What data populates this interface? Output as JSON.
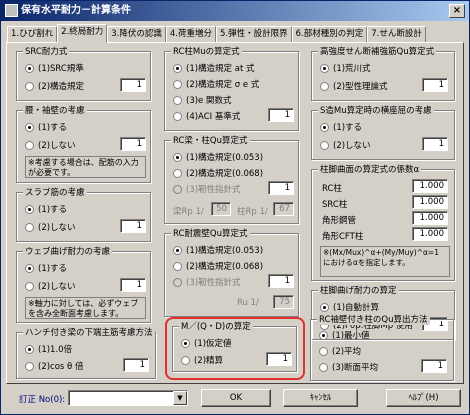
{
  "window": {
    "title": "保有水平耐力－計算条件",
    "close": "×"
  },
  "tabs": [
    "1.ひび割れ",
    "2.終局耐力",
    "3.降伏の認識",
    "4.荷重増分",
    "5.弾性・設計限界",
    "6.部材種別の判定",
    "7.せん断設計"
  ],
  "src": {
    "legend": "SRC耐力式",
    "opts": [
      "(1)SRC規準",
      "(2)構造規定"
    ],
    "val": "1"
  },
  "koshi": {
    "legend": "腰・袖壁の考慮",
    "opts": [
      "(1)する",
      "(2)しない"
    ],
    "val": "1",
    "note": "※考慮する場合は、配筋の入力が必要です。"
  },
  "slab": {
    "legend": "スラブ筋の考慮",
    "opts": [
      "(1)する",
      "(2)しない"
    ],
    "val": "1"
  },
  "web": {
    "legend": "ウェブ曲げ耐力の考慮",
    "opts": [
      "(1)する",
      "(2)しない"
    ],
    "val": "1",
    "note": "※軸力に対しては、必ずウェブを含み全断面考慮します。"
  },
  "haunch": {
    "legend": "ハンチ付き梁の下端主筋考慮方法",
    "opts": [
      "(1)1.0倍",
      "(2)cos θ 倍"
    ],
    "val": "1"
  },
  "rcmu": {
    "legend": "RC柱Muの算定式",
    "opts": [
      "(1)構造規定 at 式",
      "(2)構造規定 σ e 式",
      "(3)e 関数式",
      "(4)ACI 基準式"
    ],
    "val": "1"
  },
  "rcqu": {
    "legend": "RC梁・柱Qu算定式",
    "opts": [
      "(1)構造規定(0.053)",
      "(2)構造規定(0.068)",
      "(3)靭性指針式"
    ],
    "val": "1",
    "rp_beam_label": "梁Rp 1/",
    "rp_beam": "50",
    "rp_col_label": "柱Rp 1/",
    "rp_col": "67"
  },
  "wallqu": {
    "legend": "RC耐震壁Qu算定式",
    "opts": [
      "(1)構造規定(0.053)",
      "(2)構造規定(0.068)",
      "(3)靭性指針式"
    ],
    "val": "1",
    "ru_label": "Ru 1/",
    "ru": "75"
  },
  "mqd": {
    "legend": "M／(Q・D)の算定",
    "opts": [
      "(1)仮定値",
      "(2)精算"
    ],
    "val": "1"
  },
  "hsqu": {
    "legend": "高強度せん断補強筋Qu算定式",
    "opts": [
      "(1)荒川式",
      "(2)型性理論式"
    ],
    "val": "1"
  },
  "smu": {
    "legend": "S造Mu算定時の横座屈の考慮",
    "opts": [
      "(1)する",
      "(2)しない"
    ],
    "val": "1"
  },
  "alpha": {
    "legend": "柱脚曲面の算定式の係数α",
    "rows": [
      {
        "label": "RC柱",
        "value": "1.000"
      },
      {
        "label": "SRC柱",
        "value": "1.000"
      },
      {
        "label": "角形鋼管",
        "value": "1.000"
      },
      {
        "label": "角形CFT柱",
        "value": "1.000"
      }
    ],
    "note": "※(Mx/Mux)^α+(My/Muy)^α=1 におけるαを指定します。"
  },
  "colbend": {
    "legend": "柱脚曲げ耐力の算定",
    "opts": [
      "(1)自動計算",
      "(2)F0p.柱脚Mp 使用"
    ],
    "val": "1"
  },
  "wallcol": {
    "legend": "RC袖壁付き柱のQu算出方法",
    "opts": [
      "(1)最小値",
      "(2)平均",
      "(3)断面平均"
    ],
    "val": "1"
  },
  "bottom": {
    "correction_label": "訂正 No(0):",
    "ok": "OK",
    "cancel": "ｷｬﾝｾﾙ",
    "help": "ﾍﾙﾌﾟ(H)"
  }
}
